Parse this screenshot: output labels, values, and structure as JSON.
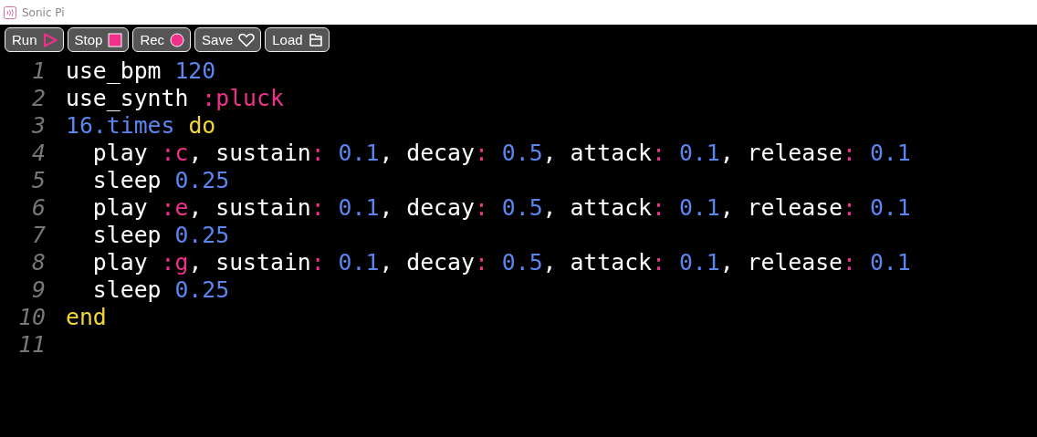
{
  "window": {
    "title": "Sonic Pi"
  },
  "toolbar": [
    {
      "label": "Run",
      "kind": "run"
    },
    {
      "label": "Stop",
      "kind": "stop"
    },
    {
      "label": "Rec",
      "kind": "rec"
    },
    {
      "label": "Save",
      "kind": "save"
    },
    {
      "label": "Load",
      "kind": "load"
    }
  ],
  "editor": {
    "lines": [
      {
        "number": "1",
        "tokens": [
          {
            "kind": "plain",
            "text": "use_bpm "
          },
          {
            "kind": "number",
            "text": "120"
          }
        ]
      },
      {
        "number": "2",
        "tokens": [
          {
            "kind": "plain",
            "text": "use_synth "
          },
          {
            "kind": "symbol",
            "text": ":pluck"
          }
        ]
      },
      {
        "number": "3",
        "tokens": [
          {
            "kind": "number",
            "text": "16.times "
          },
          {
            "kind": "keyword",
            "text": "do"
          }
        ]
      },
      {
        "number": "4",
        "tokens": [
          {
            "kind": "plain",
            "text": "  play "
          },
          {
            "kind": "symbol",
            "text": ":c"
          },
          {
            "kind": "plain",
            "text": ", sustain"
          },
          {
            "kind": "symbol",
            "text": ":"
          },
          {
            "kind": "number",
            "text": " 0.1"
          },
          {
            "kind": "plain",
            "text": ", decay"
          },
          {
            "kind": "symbol",
            "text": ":"
          },
          {
            "kind": "number",
            "text": " 0.5"
          },
          {
            "kind": "plain",
            "text": ", attack"
          },
          {
            "kind": "symbol",
            "text": ":"
          },
          {
            "kind": "number",
            "text": " 0.1"
          },
          {
            "kind": "plain",
            "text": ", release"
          },
          {
            "kind": "symbol",
            "text": ":"
          },
          {
            "kind": "number",
            "text": " 0.1"
          }
        ]
      },
      {
        "number": "5",
        "tokens": [
          {
            "kind": "plain",
            "text": "  sleep "
          },
          {
            "kind": "number",
            "text": "0.25"
          }
        ]
      },
      {
        "number": "6",
        "tokens": [
          {
            "kind": "plain",
            "text": "  play "
          },
          {
            "kind": "symbol",
            "text": ":e"
          },
          {
            "kind": "plain",
            "text": ", sustain"
          },
          {
            "kind": "symbol",
            "text": ":"
          },
          {
            "kind": "number",
            "text": " 0.1"
          },
          {
            "kind": "plain",
            "text": ", decay"
          },
          {
            "kind": "symbol",
            "text": ":"
          },
          {
            "kind": "number",
            "text": " 0.5"
          },
          {
            "kind": "plain",
            "text": ", attack"
          },
          {
            "kind": "symbol",
            "text": ":"
          },
          {
            "kind": "number",
            "text": " 0.1"
          },
          {
            "kind": "plain",
            "text": ", release"
          },
          {
            "kind": "symbol",
            "text": ":"
          },
          {
            "kind": "number",
            "text": " 0.1"
          }
        ]
      },
      {
        "number": "7",
        "tokens": [
          {
            "kind": "plain",
            "text": "  sleep "
          },
          {
            "kind": "number",
            "text": "0.25"
          }
        ]
      },
      {
        "number": "8",
        "tokens": [
          {
            "kind": "plain",
            "text": "  play "
          },
          {
            "kind": "symbol",
            "text": ":g"
          },
          {
            "kind": "plain",
            "text": ", sustain"
          },
          {
            "kind": "symbol",
            "text": ":"
          },
          {
            "kind": "number",
            "text": " 0.1"
          },
          {
            "kind": "plain",
            "text": ", decay"
          },
          {
            "kind": "symbol",
            "text": ":"
          },
          {
            "kind": "number",
            "text": " 0.5"
          },
          {
            "kind": "plain",
            "text": ", attack"
          },
          {
            "kind": "symbol",
            "text": ":"
          },
          {
            "kind": "number",
            "text": " 0.1"
          },
          {
            "kind": "plain",
            "text": ", release"
          },
          {
            "kind": "symbol",
            "text": ":"
          },
          {
            "kind": "number",
            "text": " 0.1"
          }
        ]
      },
      {
        "number": "9",
        "tokens": [
          {
            "kind": "plain",
            "text": "  sleep "
          },
          {
            "kind": "number",
            "text": "0.25"
          }
        ]
      },
      {
        "number": "10",
        "tokens": [
          {
            "kind": "keyword",
            "text": "end"
          }
        ]
      },
      {
        "number": "11"
      }
    ]
  }
}
